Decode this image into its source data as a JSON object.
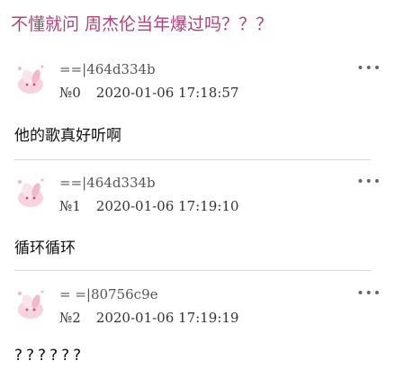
{
  "thread": {
    "title": "不懂就问 周杰伦当年爆过吗？？？"
  },
  "posts": [
    {
      "user_id": "==|464d334b",
      "floor": "№0",
      "time": "2020-01-06 17:18:57",
      "content": "他的歌真好听啊",
      "more_icon": "more-icon"
    },
    {
      "user_id": "==|464d334b",
      "floor": "№1",
      "time": "2020-01-06 17:19:10",
      "content": "循环循环",
      "more_icon": "more-icon"
    },
    {
      "user_id": "= =|80756c9e",
      "floor": "№2",
      "time": "2020-01-06 17:19:19",
      "content": "??????",
      "more_icon": "more-icon"
    }
  ],
  "colors": {
    "title": "#b0407a",
    "divider": "#d8d8d8",
    "avatar_pink": "#f4b8cc"
  },
  "more_glyph": "•••"
}
